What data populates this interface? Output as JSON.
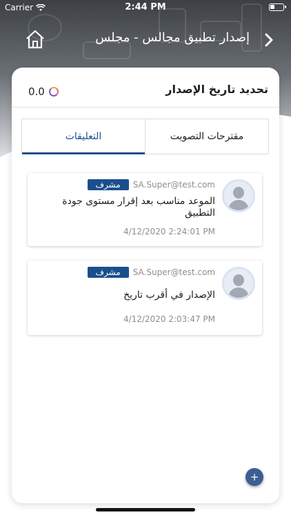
{
  "status_bar": {
    "carrier": "Carrier",
    "time": "2:44 PM"
  },
  "nav": {
    "title": "إصدار تطبيق مجالس - مجلس",
    "home_icon": "home-icon",
    "back_icon": "chevron-right-icon"
  },
  "card": {
    "title": "تحديد تاريخ الإصدار",
    "score": "0.0",
    "tabs": [
      {
        "label": "مقترحات التصويت",
        "active": false
      },
      {
        "label": "التعليقات",
        "active": true
      }
    ]
  },
  "comments": [
    {
      "email": "SA.Super@test.com",
      "badge": "مشرف",
      "text": "الموعد مناسب بعد إقرار مستوى جودة التطبيق",
      "time": "4/12/2020 2:24:01 PM"
    },
    {
      "email": "SA.Super@test.com",
      "badge": "مشرف",
      "text": "الإصدار في أقرب تاريخ",
      "time": "4/12/2020 2:03:47 PM"
    }
  ],
  "fab_label": "+",
  "colors": {
    "accent": "#1b4f8c",
    "fab": "#3d5d93"
  }
}
